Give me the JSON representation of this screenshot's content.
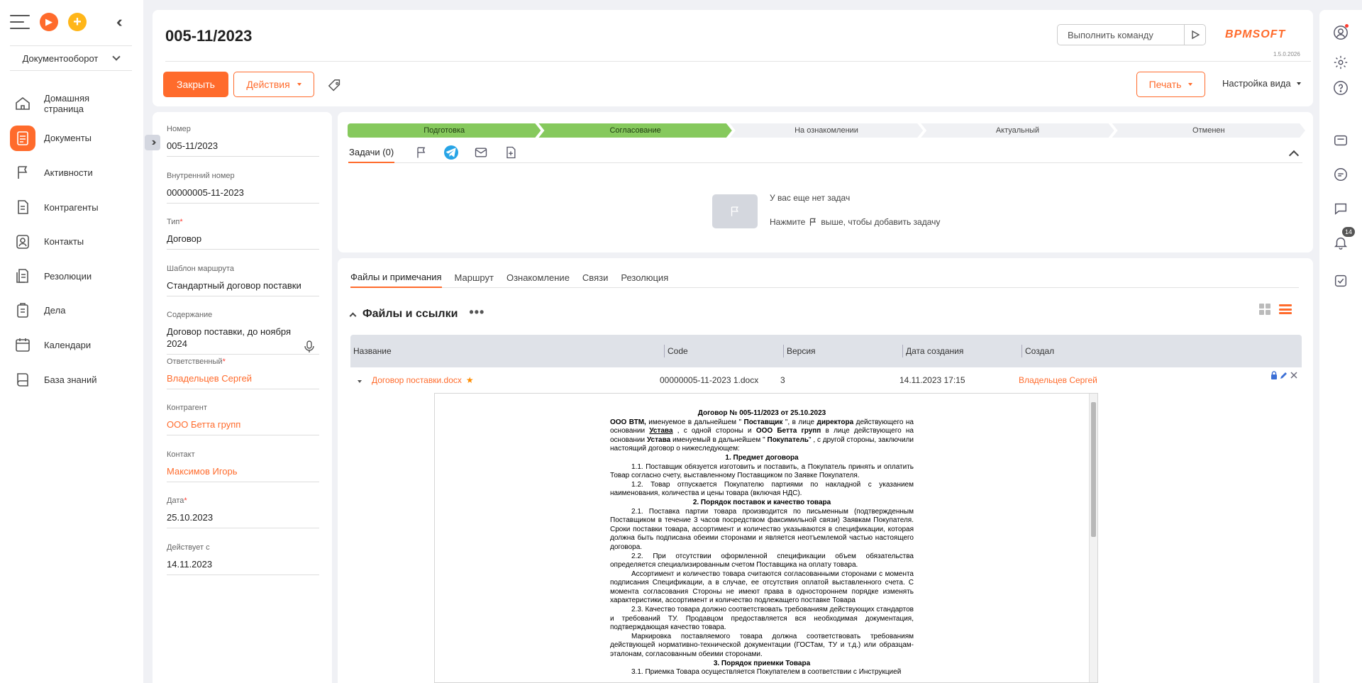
{
  "nav": {
    "workplace": "Документооборот",
    "items": [
      {
        "label": "Домашняя страница",
        "icon": "home-icon"
      },
      {
        "label": "Документы",
        "icon": "document-icon",
        "active": true
      },
      {
        "label": "Активности",
        "icon": "flag-icon"
      },
      {
        "label": "Контрагенты",
        "icon": "building-icon"
      },
      {
        "label": "Контакты",
        "icon": "contact-icon"
      },
      {
        "label": "Резолюции",
        "icon": "resolution-icon"
      },
      {
        "label": "Дела",
        "icon": "case-icon"
      },
      {
        "label": "Календари",
        "icon": "calendar-icon"
      },
      {
        "label": "База знаний",
        "icon": "book-icon"
      }
    ]
  },
  "header": {
    "title": "005-11/2023",
    "command_placeholder": "Выполнить команду",
    "logo": "BPMSOFT",
    "version": "1.5.0.2026",
    "close_label": "Закрыть",
    "actions_label": "Действия",
    "print_label": "Печать",
    "view_settings_label": "Настройка вида"
  },
  "fields": [
    {
      "label": "Номер",
      "value": "005-11/2023",
      "required": false,
      "link": false
    },
    {
      "label": "Внутренний номер",
      "value": "00000005-11-2023",
      "required": false,
      "link": false
    },
    {
      "label": "Тип",
      "value": "Договор",
      "required": true,
      "link": false
    },
    {
      "label": "Шаблон маршрута",
      "value": "Стандартный договор поставки",
      "required": false,
      "link": false
    },
    {
      "label": "Содержание",
      "value": "Договор поставки, до ноября 2024",
      "required": false,
      "link": false
    },
    {
      "label": "Ответственный",
      "value": "Владельцев Сергей",
      "required": true,
      "link": true
    },
    {
      "label": "Контрагент",
      "value": "ООО Бетта групп",
      "required": false,
      "link": true
    },
    {
      "label": "Контакт",
      "value": "Максимов Игорь",
      "required": false,
      "link": true
    },
    {
      "label": "Дата",
      "value": "25.10.2023",
      "required": true,
      "link": false
    },
    {
      "label": "Действует с",
      "value": "14.11.2023",
      "required": false,
      "link": false
    }
  ],
  "stages": [
    {
      "label": "Подготовка",
      "done": true
    },
    {
      "label": "Согласование",
      "done": true
    },
    {
      "label": "На ознакомлении",
      "done": false
    },
    {
      "label": "Актуальный",
      "done": false
    },
    {
      "label": "Отменен",
      "done": false
    }
  ],
  "tasks": {
    "tab_label": "Задачи (0)",
    "empty_title": "У вас еще нет задач",
    "empty_hint_before": "Нажмите",
    "empty_hint_after": "выше, чтобы добавить задачу"
  },
  "files_tabs": [
    "Файлы и примечания",
    "Маршрут",
    "Ознакомление",
    "Связи",
    "Резолюция"
  ],
  "files": {
    "section_title": "Файлы и ссылки",
    "columns": [
      "Название",
      "Code",
      "Версия",
      "Дата создания",
      "Создал"
    ],
    "rows": [
      {
        "name": "Договор поставки.docx",
        "code": "00000005-11-2023 1.docx",
        "version": "3",
        "created": "14.11.2023 17:15",
        "author": "Владельцев Сергей"
      }
    ]
  },
  "right_rail": {
    "notifications_count": "14"
  },
  "document_preview": [
    {
      "t": "c",
      "text": "Договор № 005-11/2023 от 25.10.2023"
    },
    {
      "t": "p",
      "html": "<b>ООО ВТМ,</b>   именуемое в дальнейшем \" <b>Поставщик</b> \", в лице  <b>директора</b> действующего на основании <b><u>Устава</u></b> , с одной стороны и <b>ООО Бетта групп</b>  в лице действующего на основании <b>Устава</b> именуемый в дальнейшем \" <b>Покупатель</b>\" , с другой стороны, заключили настоящий договор о нижеследующем:"
    },
    {
      "t": "c",
      "text": "1. Предмет договора"
    },
    {
      "t": "i",
      "text": "1.1. Поставщик обязуется изготовить и поставить, а Покупатель принять и оплатить Товар согласно счету, выставленному Поставщиком по Заявке Покупателя."
    },
    {
      "t": "i",
      "text": "1.2. Товар отпускается Покупателю партиями по накладной с указанием наименования, количества и цены товара (включая НДС)."
    },
    {
      "t": "c",
      "text": "2. Порядок поставок и качество товара"
    },
    {
      "t": "i",
      "text": "2.1. Поставка партии товара производится по письменным (подтвержденным Поставщиком в течение 3 часов посредством факсимильной связи) Заявкам Покупателя. Сроки поставки товара, ассортимент и количество указываются в спецификации, которая должна быть подписана обеими сторонами и является неотъемлемой частью настоящего договора."
    },
    {
      "t": "i",
      "text": "2.2. При отсутствии оформленной спецификации объем обязательства определяется специализированным счетом Поставщика на оплату товара."
    },
    {
      "t": "i",
      "text": "Ассортимент и количество товара считаются согласованными сторонами с момента подписания Спецификации, а в случае, ее отсутствия оплатой выставленного счета. С момента согласования Стороны не имеют права в одностороннем порядке изменять характеристики, ассортимент и количество подлежащего поставке Товара"
    },
    {
      "t": "i",
      "text": "2.3. Качество товара должно соответствовать требованиям действующих стандартов и требований ТУ. Продавцом предоставляется  вся необходимая документация, подтверждающая качество товара."
    },
    {
      "t": "i",
      "text": "Маркировка поставляемого товара должна соответствовать требованиям действующей нормативно-технической документации (ГОСТам, ТУ и т.д.) или образцам-эталонам, согласованным обеими сторонами."
    },
    {
      "t": "c",
      "text": "3. Порядок приемки Товара"
    },
    {
      "t": "i",
      "text": "3.1. Приемка Товара осуществляется Покупателем в соответствии с Инструкцией"
    }
  ]
}
